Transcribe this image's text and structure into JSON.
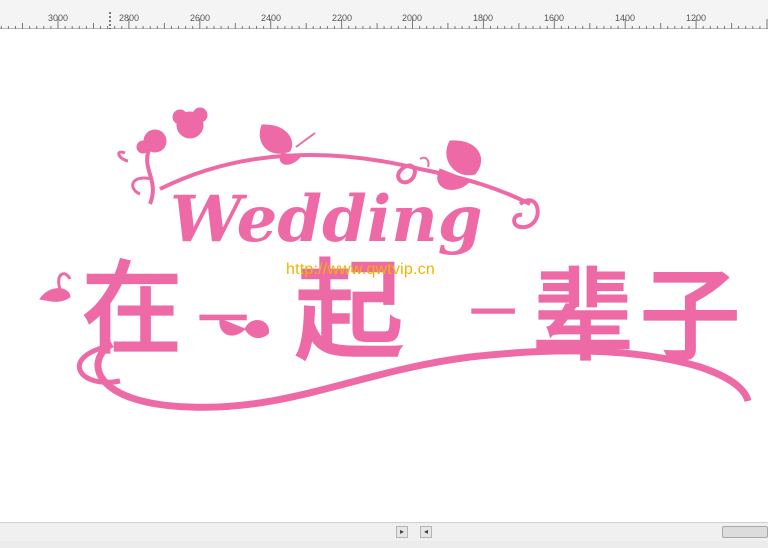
{
  "ruler": {
    "labels": [
      "3000",
      "2800",
      "2600",
      "2400",
      "2200",
      "2000",
      "1800",
      "1600",
      "1400",
      "1200"
    ]
  },
  "artwork": {
    "title_en": "Wedding",
    "title_cn": "在一起一辈子",
    "color": "#ee6aa7"
  },
  "watermark": {
    "text": "http://www.qwtvip.cn",
    "color": "#f0b400"
  },
  "scrollbar": {
    "left_arrow_icon": "chevron-left-icon",
    "right_arrow_icon": "chevron-right-icon"
  }
}
